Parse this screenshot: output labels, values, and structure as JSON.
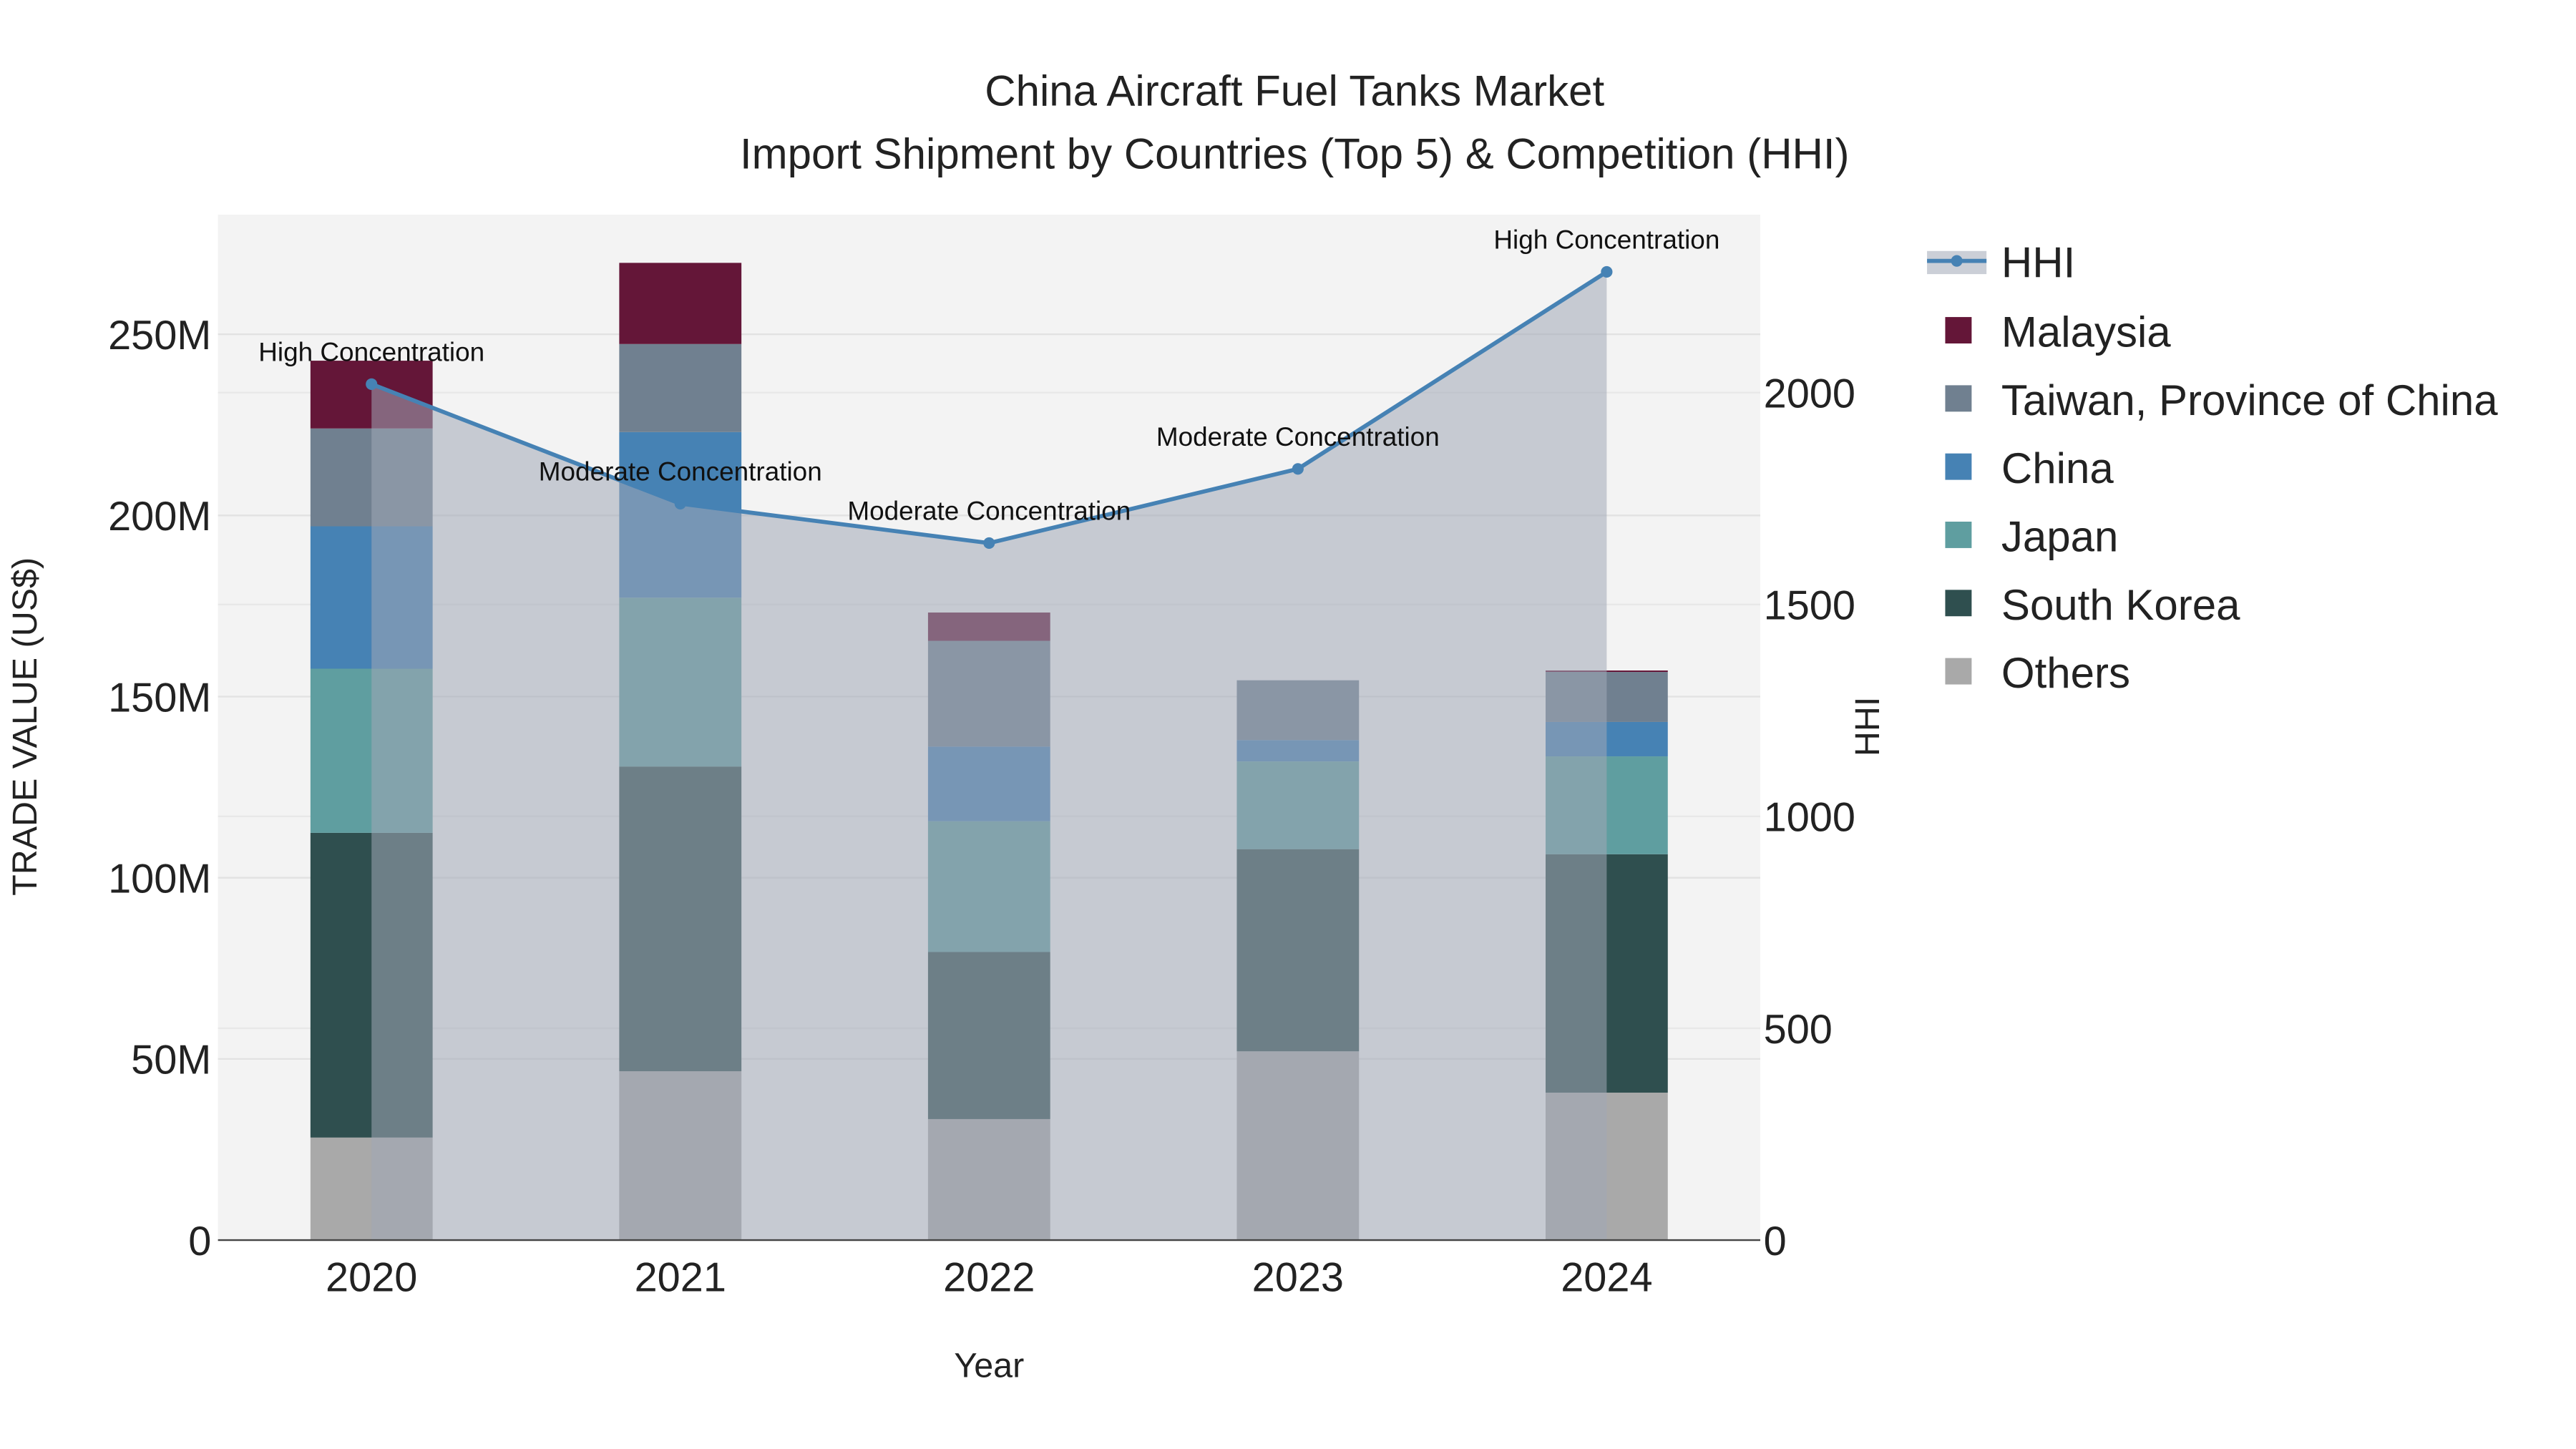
{
  "chart_data": {
    "type": "bar",
    "title": "China Aircraft Fuel Tanks Market",
    "subtitle": "Import Shipment by Countries (Top 5) & Competition (HHI)",
    "xlabel": "Year",
    "ylabel": "TRADE VALUE (US$)",
    "y2label": "HHI",
    "categories": [
      "2020",
      "2021",
      "2022",
      "2023",
      "2024"
    ],
    "ylim": [
      0,
      283
    ],
    "y2lim": [
      0,
      2420
    ],
    "yticks": [
      {
        "v": 0,
        "label": "0"
      },
      {
        "v": 50,
        "label": "50M"
      },
      {
        "v": 100,
        "label": "100M"
      },
      {
        "v": 150,
        "label": "150M"
      },
      {
        "v": 200,
        "label": "200M"
      },
      {
        "v": 250,
        "label": "250M"
      }
    ],
    "y2ticks": [
      {
        "v": 0,
        "label": "0"
      },
      {
        "v": 500,
        "label": "500"
      },
      {
        "v": 1000,
        "label": "1000"
      },
      {
        "v": 1500,
        "label": "1500"
      },
      {
        "v": 2000,
        "label": "2000"
      }
    ],
    "units": "million US$",
    "stack_order": [
      "Others",
      "South Korea",
      "Japan",
      "China",
      "Taiwan, Province of China",
      "Malaysia"
    ],
    "series": [
      {
        "name": "Others",
        "color": "#a9a9a9",
        "values": [
          28.3,
          46.6,
          33.4,
          52.1,
          40.7
        ]
      },
      {
        "name": "South Korea",
        "color": "#2f4f4f",
        "values": [
          84.1,
          84.1,
          46.1,
          55.8,
          65.8
        ]
      },
      {
        "name": "Japan",
        "color": "#5f9ea0",
        "values": [
          45.3,
          46.6,
          36.1,
          24.2,
          27.0
        ]
      },
      {
        "name": "China",
        "color": "#4682b4",
        "values": [
          39.3,
          45.7,
          20.6,
          5.9,
          9.5
        ]
      },
      {
        "name": "Taiwan, Province of China",
        "color": "#708090",
        "values": [
          27.0,
          24.3,
          29.2,
          16.5,
          13.8
        ]
      },
      {
        "name": "Malaysia",
        "color": "#641638",
        "values": [
          18.7,
          22.4,
          7.8,
          0.0,
          0.4
        ]
      }
    ],
    "hhi": {
      "name": "HHI",
      "color": "#4682b4",
      "values": [
        2020,
        1738,
        1645,
        1820,
        2285
      ],
      "annotations": [
        "High Concentration",
        "Moderate Concentration",
        "Moderate Concentration",
        "Moderate Concentration",
        "High Concentration"
      ]
    },
    "legend": [
      "HHI",
      "Malaysia",
      "Taiwan, Province of China",
      "China",
      "Japan",
      "South Korea",
      "Others"
    ],
    "legend_placement": "right",
    "grid": true
  }
}
